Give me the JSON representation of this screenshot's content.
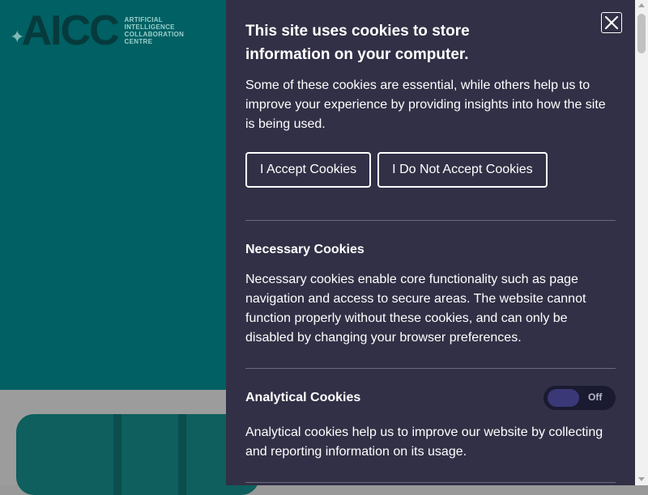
{
  "brand": {
    "logo_letters": "AICC",
    "logo_lines": [
      "ARTIFICIAL",
      "INTELLIGENCE",
      "COLLABORATION",
      "CENTRE"
    ]
  },
  "cookie_panel": {
    "title": "This site uses cookies to store information on your computer.",
    "intro": "Some of these cookies are essential, while others help us to improve your experience by providing insights into how the site is being used.",
    "accept_label": "I Accept Cookies",
    "reject_label": "I Do Not Accept Cookies",
    "close_icon": "close-icon",
    "sections": [
      {
        "heading": "Necessary Cookies",
        "text": "Necessary cookies enable core functionality such as page navigation and access to secure areas. The website cannot function properly without these cookies, and can only be disabled by changing your browser preferences."
      },
      {
        "heading": "Analytical Cookies",
        "toggle_state": "Off",
        "text": "Analytical cookies help us to improve our website by collecting and reporting information on its usage."
      }
    ]
  },
  "colors": {
    "hero": "#006063",
    "panel": "#323046",
    "toggle_knob": "#3a3877"
  }
}
